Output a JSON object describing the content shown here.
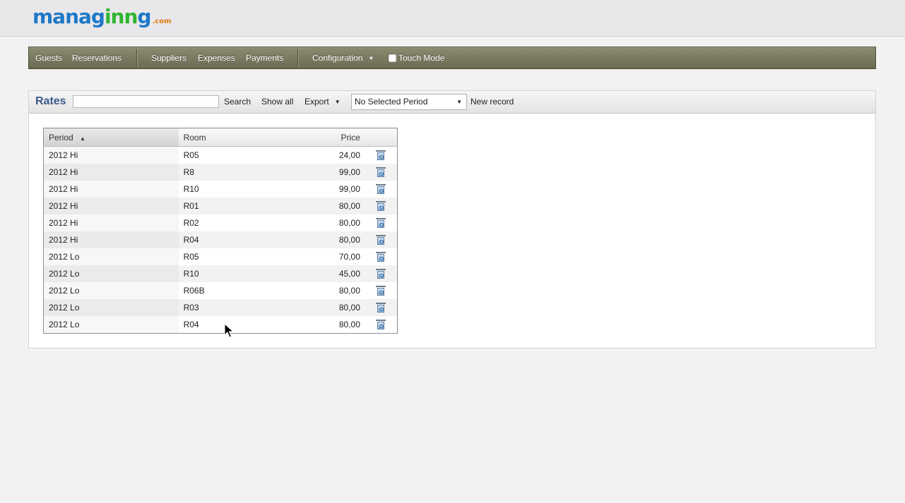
{
  "logo": {
    "part1": "manag",
    "part2": "inn",
    "part3": "g",
    "suffix": ".com"
  },
  "nav": {
    "guests": "Guests",
    "reservations": "Reservations",
    "suppliers": "Suppliers",
    "expenses": "Expenses",
    "payments": "Payments",
    "configuration": "Configuration",
    "touch_mode": "Touch Mode"
  },
  "panel": {
    "title": "Rates",
    "search_value": "",
    "search_label": "Search",
    "show_all_label": "Show all",
    "export_label": "Export",
    "period_selected": "No Selected Period",
    "new_record_label": "New record"
  },
  "table": {
    "headers": {
      "period": "Period",
      "room": "Room",
      "price": "Price"
    },
    "sorted_by": "period",
    "sort_direction": "asc",
    "rows": [
      {
        "period": "2012 Hi",
        "room": "R05",
        "price": "24,00"
      },
      {
        "period": "2012 Hi",
        "room": "R8",
        "price": "99,00"
      },
      {
        "period": "2012 Hi",
        "room": "R10",
        "price": "99,00"
      },
      {
        "period": "2012 Hi",
        "room": "R01",
        "price": "80,00"
      },
      {
        "period": "2012 Hi",
        "room": "R02",
        "price": "80,00"
      },
      {
        "period": "2012 Hi",
        "room": "R04",
        "price": "80,00"
      },
      {
        "period": "2012 Lo",
        "room": "R05",
        "price": "70,00"
      },
      {
        "period": "2012 Lo",
        "room": "R10",
        "price": "45,00"
      },
      {
        "period": "2012 Lo",
        "room": "R06B",
        "price": "80,00"
      },
      {
        "period": "2012 Lo",
        "room": "R03",
        "price": "80,00"
      },
      {
        "period": "2012 Lo",
        "room": "R04",
        "price": "80,00"
      }
    ],
    "row_action_icon": "trash-icon"
  },
  "colors": {
    "navbar": "#7a7b61",
    "title": "#3d5a8a",
    "logo_blue": "#1f78c8",
    "logo_green": "#2fb52f",
    "logo_orange": "#e07a10"
  }
}
